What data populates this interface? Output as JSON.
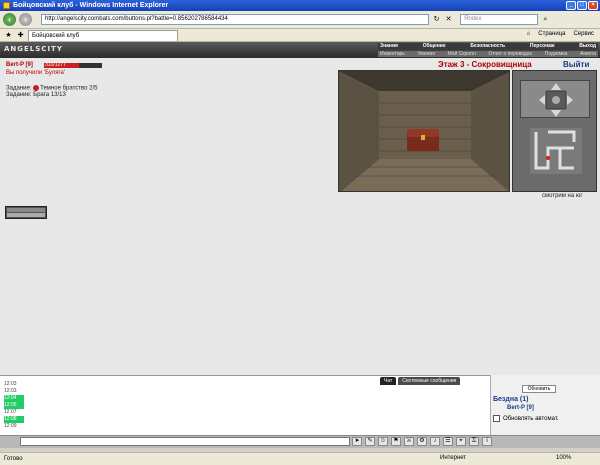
{
  "window": {
    "title": "Бойцовский клуб - Windows Internet Explorer"
  },
  "browser": {
    "url": "http://angelscity.combats.com/buttons.pl?battle=0.856202786584434",
    "search_placeholder": "Яndex",
    "tab_label": "Бойцовский клуб",
    "tools": [
      "Страница",
      "Сервис"
    ]
  },
  "game": {
    "logo": "ANGELSCITY",
    "top_menu": [
      "Знания",
      "Общение",
      "Безопасность",
      "Персонаж",
      "Выход"
    ],
    "sub_menu": [
      "Инвентарь",
      "Умения",
      "Мой Скролл",
      "Отчет о переводах",
      "Подземка",
      "Анкета"
    ]
  },
  "character": {
    "name": "Bert-P [9]",
    "hp_text": "310/1277",
    "hp_fraction": 0.6,
    "received": "Вы получили 'Буляга'",
    "tasks": [
      {
        "label": "Задание:",
        "value": "Темное братство 2/5"
      },
      {
        "label": "Задание:",
        "value": "Брага 13/13"
      }
    ]
  },
  "dungeon": {
    "floor_title": "Этаж 3 - Сокровищница",
    "exit": "Выйти",
    "facing": "смотрим на юг"
  },
  "chat": {
    "tabs": [
      "Чат",
      "Системные сообщения"
    ],
    "times": [
      "12:03",
      "12:03",
      "12:04",
      "12:05",
      "12:07",
      "12:08",
      "12:09"
    ]
  },
  "side": {
    "refresh": "Обновить",
    "location": "Бездна (1)",
    "player": "Bert-P [9]",
    "auto_refresh": "Обновлять автомат."
  },
  "status": {
    "ready": "Готово",
    "zone": "Интернет",
    "zoom": "100%"
  }
}
